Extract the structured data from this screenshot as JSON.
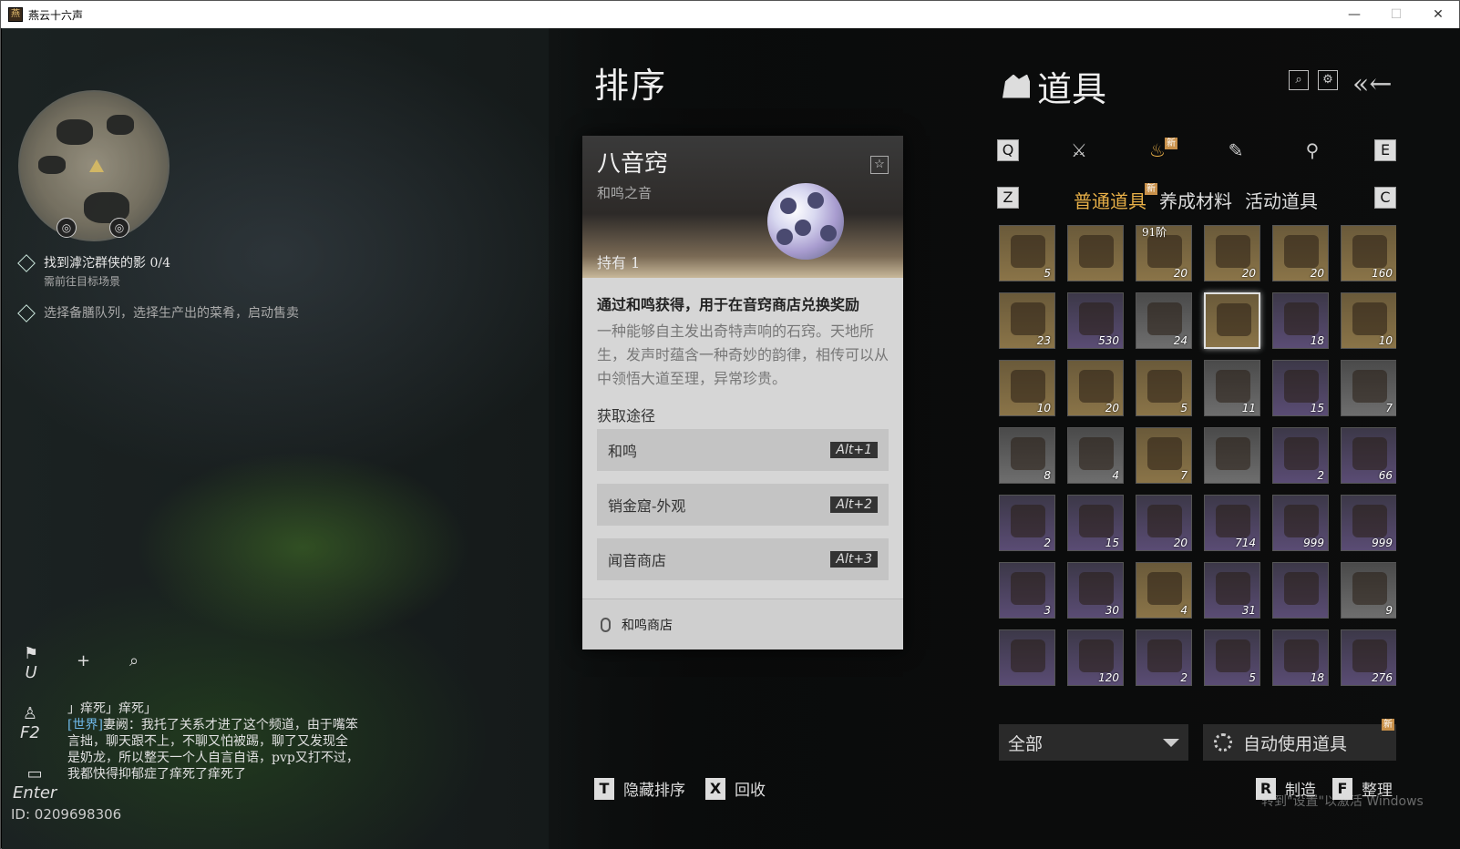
{
  "window": {
    "title": "燕云十六声",
    "app_icon": "燕"
  },
  "quests": [
    {
      "text": "找到滹沱群侠的影 0/4",
      "sub": "需前往目标场景"
    },
    {
      "text": "选择备膳队列，选择生产出的菜肴，启动售卖"
    }
  ],
  "left_bar": {
    "flag_key": "U",
    "profile_key": "F2",
    "chat_key": "Enter",
    "plus": "+",
    "search": "⌕"
  },
  "chat": {
    "line1": "」痒死」痒死」",
    "channel": "[世界]",
    "message": "妻阙：我托了关系才进了这个频道，由于嘴笨言拙，聊天跟不上，不聊又怕被踢，聊了又发现全是奶龙，所以整天一个人自言自语，pvp又打不过，我都快得抑郁症了痒死了痒死了"
  },
  "player_id": "ID: 0209698306",
  "sort_title": "排序",
  "card": {
    "name": "八音窍",
    "subtitle": "和鸣之音",
    "owned": "持有 1",
    "star": "☆",
    "desc_main": "通过和鸣获得，用于在音窍商店兑换奖励",
    "desc_flavor": "一种能够自主发出奇特声响的石窍。天地所生，发声时蕴含一种奇妙的韵律，相传可以从中领悟大道至理，异常珍贵。",
    "source_label": "获取途径",
    "routes": [
      {
        "label": "和鸣",
        "key": "Alt+1"
      },
      {
        "label": "销金窟-外观",
        "key": "Alt+2"
      },
      {
        "label": "闻音商店",
        "key": "Alt+3"
      }
    ],
    "footer": "和鸣商店"
  },
  "panel": {
    "title": "道具",
    "tab_keys": {
      "left": "Q",
      "right": "E",
      "sub_left": "Z",
      "sub_right": "C"
    },
    "new_badge": "新",
    "subtabs": [
      "普通道具",
      "养成材料",
      "活动道具"
    ],
    "items": [
      {
        "count": "5"
      },
      {
        "count": ""
      },
      {
        "count": "20",
        "tag": "91阶"
      },
      {
        "count": "20"
      },
      {
        "count": "20"
      },
      {
        "count": "160"
      },
      {
        "count": "23"
      },
      {
        "count": "530"
      },
      {
        "count": "24"
      },
      {
        "count": ""
      },
      {
        "count": "18"
      },
      {
        "count": "10"
      },
      {
        "count": "10"
      },
      {
        "count": "20"
      },
      {
        "count": "5"
      },
      {
        "count": "11"
      },
      {
        "count": "15"
      },
      {
        "count": "7"
      },
      {
        "count": "8"
      },
      {
        "count": "4"
      },
      {
        "count": "7"
      },
      {
        "count": ""
      },
      {
        "count": "2"
      },
      {
        "count": "66"
      },
      {
        "count": "2"
      },
      {
        "count": "15"
      },
      {
        "count": "20"
      },
      {
        "count": "714"
      },
      {
        "count": "999"
      },
      {
        "count": "999"
      },
      {
        "count": "3"
      },
      {
        "count": "30"
      },
      {
        "count": "4"
      },
      {
        "count": "31"
      },
      {
        "count": ""
      },
      {
        "count": "9"
      },
      {
        "count": ""
      },
      {
        "count": "120"
      },
      {
        "count": "2"
      },
      {
        "count": "5"
      },
      {
        "count": "18"
      },
      {
        "count": "276"
      }
    ],
    "filter_value": "全部",
    "auto_use": "自动使用道具"
  },
  "bottom": {
    "hide_sort": {
      "key": "T",
      "label": "隐藏排序"
    },
    "recycle": {
      "key": "X",
      "label": "回收"
    },
    "make": {
      "key": "R",
      "label": "制造"
    },
    "organize": {
      "key": "F",
      "label": "整理"
    }
  },
  "watermark": "转到\"设置\"以激活 Windows"
}
